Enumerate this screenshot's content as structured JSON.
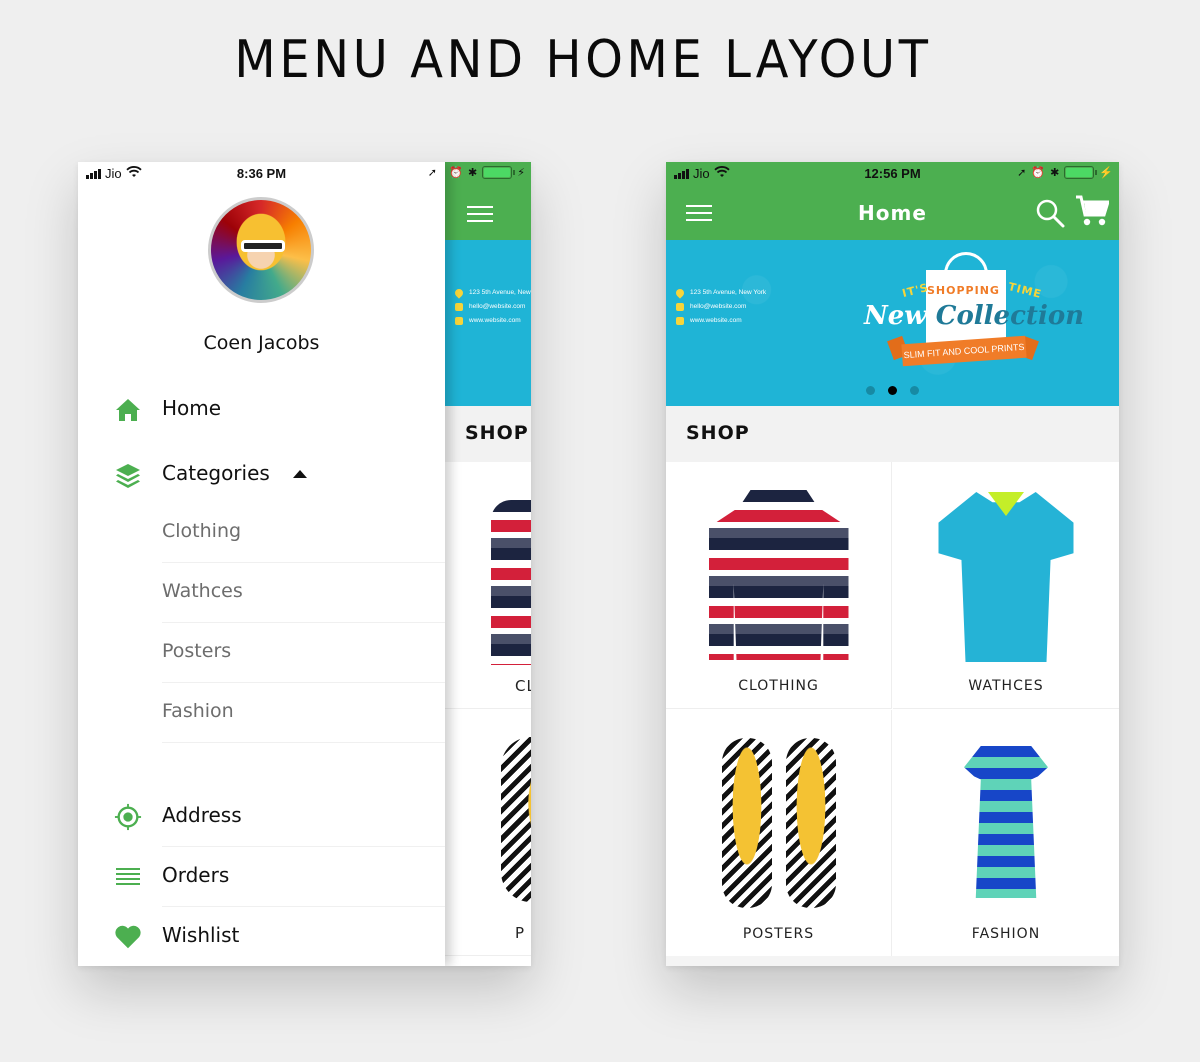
{
  "page_title": "MENU AND HOME LAYOUT",
  "left_phone": {
    "status": {
      "carrier": "Jio",
      "time": "8:36 PM"
    },
    "drawer": {
      "user_name": "Coen Jacobs",
      "menu": [
        {
          "label": "Home",
          "icon": "home-icon"
        },
        {
          "label": "Categories",
          "icon": "layers-icon",
          "expanded": true
        }
      ],
      "subcategories": [
        "Clothing",
        "Wathces",
        "Posters",
        "Fashion"
      ],
      "bottom_menu": [
        {
          "label": "Address",
          "icon": "target-icon"
        },
        {
          "label": "Orders",
          "icon": "list-icon"
        },
        {
          "label": "Wishlist",
          "icon": "heart-icon"
        }
      ]
    },
    "behind": {
      "shop_title": "SHOP",
      "tile_labels": [
        "CL",
        "P"
      ],
      "contact": [
        "123 5th Avenue, New",
        "hello@website.com",
        "www.website.com"
      ]
    }
  },
  "right_phone": {
    "status": {
      "carrier": "Jio",
      "time": "12:56 PM"
    },
    "appbar": {
      "title": "Home"
    },
    "banner": {
      "contact": [
        "123 5th Avenue, New York",
        "hello@website.com",
        "www.website.com"
      ],
      "its": "IT'S",
      "shopping": "SHOPPING",
      "time": "TIME",
      "headline_1": "New",
      "headline_2": "Collection",
      "ribbon": "SLIM FIT AND COOL PRINTS",
      "slides": 3,
      "active_slide": 2
    },
    "shop_title": "SHOP",
    "categories": [
      "CLOTHING",
      "WATHCES",
      "POSTERS",
      "FASHION"
    ]
  },
  "colors": {
    "primary_green": "#4caf50",
    "banner_blue": "#1fb4d6",
    "accent_orange": "#f07c28"
  }
}
